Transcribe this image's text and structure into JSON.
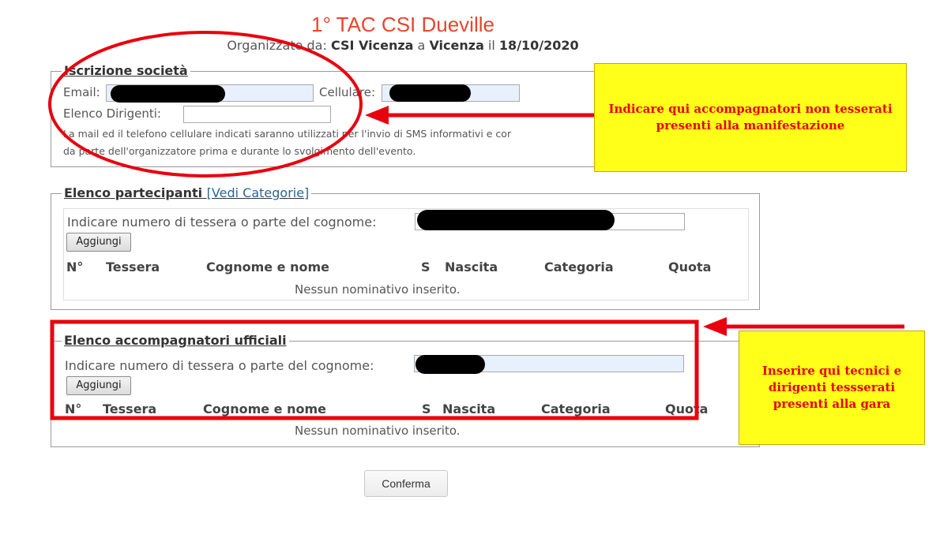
{
  "header": {
    "title": "1° TAC CSI Dueville",
    "organized_prefix": "Organizzato da: ",
    "organizer": "CSI Vicenza",
    "at_word": " a ",
    "city": "Vicenza",
    "on_word": " il ",
    "date": "18/10/2020"
  },
  "iscrizione": {
    "legend": "Iscrizione società",
    "email_label": "Email:",
    "email_value": "",
    "cellulare_label": "Cellulare:",
    "cellulare_value": "",
    "dirigenti_label": "Elenco Dirigenti:",
    "dirigenti_value": "",
    "note_line1": "La mail ed il telefono cellulare indicati saranno utilizzati per l'invio di SMS informativi e cor",
    "note_line2": "da parte dell'organizzatore prima e durante lo svolgimento dell'evento."
  },
  "partecipanti": {
    "legend": "Elenco partecipanti",
    "link": "[Vedi Categorie]",
    "search_label": "Indicare numero di tessera o parte del cognome:",
    "search_value": "",
    "add_button": "Aggiungi",
    "columns": [
      "N°",
      "Tessera",
      "Cognome e nome",
      "S",
      "Nascita",
      "Categoria",
      "Quota"
    ],
    "empty_text": "Nessun nominativo inserito."
  },
  "accompagnatori": {
    "legend": "Elenco accompagnatori ufficiali",
    "search_label": "Indicare numero di tessera o parte del cognome:",
    "search_value": "",
    "add_button": "Aggiungi",
    "columns": [
      "N°",
      "Tessera",
      "Cognome e nome",
      "S",
      "Nascita",
      "Categoria",
      "Quota"
    ],
    "empty_text": "Nessun nominativo inserito."
  },
  "annotations": {
    "callout_top": "Indicare qui accompagnatori non tesserati presenti alla manifestazione",
    "callout_bottom": "Inserire qui tecnici e dirigenti tessserati presenti alla gara",
    "annotation_color": "#e8000e",
    "callout_color": "#ffff1a"
  },
  "confirm_button": "Conferma"
}
